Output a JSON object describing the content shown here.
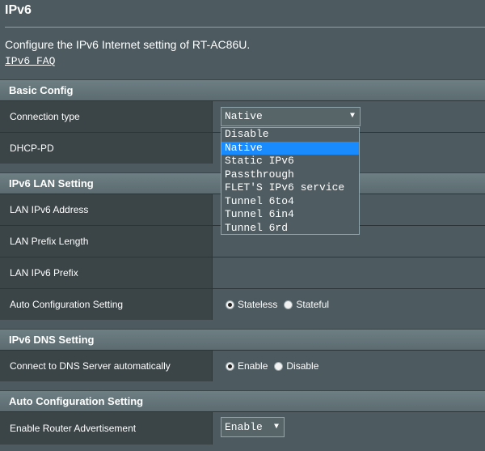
{
  "page": {
    "title": "IPv6",
    "description": "Configure the IPv6 Internet setting of RT-AC86U.",
    "faq_link": "IPv6 FAQ"
  },
  "basic_config": {
    "header": "Basic Config",
    "connection_type": {
      "label": "Connection type",
      "value": "Native",
      "options": [
        "Disable",
        "Native",
        "Static IPv6",
        "Passthrough",
        "FLET'S IPv6 service",
        "Tunnel 6to4",
        "Tunnel 6in4",
        "Tunnel 6rd"
      ]
    },
    "dhcp_pd": {
      "label": "DHCP-PD"
    }
  },
  "lan_setting": {
    "header": "IPv6 LAN Setting",
    "address_label": "LAN IPv6 Address",
    "prefix_length_label": "LAN Prefix Length",
    "prefix_label": "LAN IPv6 Prefix",
    "auto_config": {
      "label": "Auto Configuration Setting",
      "options": [
        "Stateless",
        "Stateful"
      ],
      "selected": "Stateless"
    }
  },
  "dns_setting": {
    "header": "IPv6 DNS Setting",
    "auto_dns": {
      "label": "Connect to DNS Server automatically",
      "options": [
        "Enable",
        "Disable"
      ],
      "selected": "Enable"
    }
  },
  "auto_config_section": {
    "header": "Auto Configuration Setting",
    "router_adv": {
      "label": "Enable Router Advertisement",
      "value": "Enable"
    }
  },
  "icons": {
    "dropdown_arrow": "▼"
  }
}
